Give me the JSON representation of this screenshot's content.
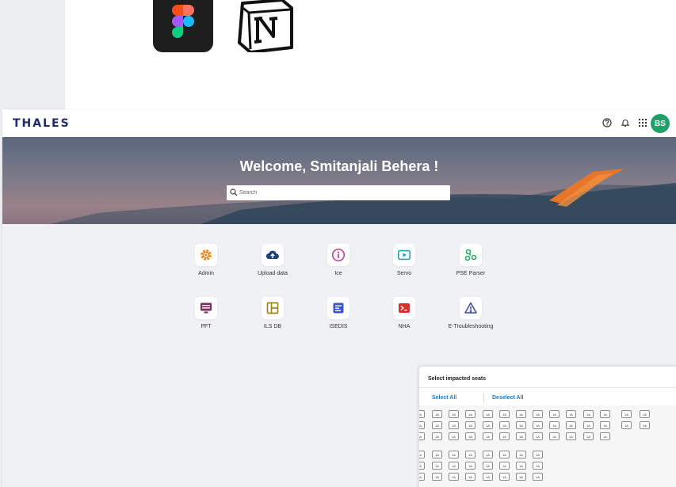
{
  "app": {
    "brand": "THALES",
    "user_initials": "BS",
    "welcome": "Welcome, Smitanjali Behera !"
  },
  "search": {
    "placeholder": "Search"
  },
  "header_icons": [
    "help-icon",
    "bell-icon",
    "apps-grid-icon"
  ],
  "tiles": [
    {
      "label": "Admin",
      "icon": "gear-icon",
      "color": "#e8871e"
    },
    {
      "label": "Upload data",
      "icon": "cloud-upload-icon",
      "color": "#1e3f7a"
    },
    {
      "label": "Ice",
      "icon": "info-icon",
      "color": "#c2439a"
    },
    {
      "label": "Servo",
      "icon": "video-play-icon",
      "color": "#1aa6b7"
    },
    {
      "label": "PSE Parser",
      "icon": "molecule-icon",
      "color": "#2aa56a"
    },
    {
      "label": "PFT",
      "icon": "monitor-icon",
      "color": "#7a2d5f"
    },
    {
      "label": "ILS DB",
      "icon": "layout-panel-icon",
      "color": "#a1821f"
    },
    {
      "label": "ISEDIS",
      "icon": "document-list-icon",
      "color": "#3f55c9"
    },
    {
      "label": "NHA",
      "icon": "terminal-icon",
      "color": "#d9302e"
    },
    {
      "label": "E-Troubleshooting",
      "icon": "warning-triangle-icon",
      "color": "#3a4a9a"
    }
  ],
  "seat_picker": {
    "title": "Select impacted seats",
    "select_all": "Select All",
    "deselect_all": "Deselect All",
    "seat_label": "1A"
  }
}
